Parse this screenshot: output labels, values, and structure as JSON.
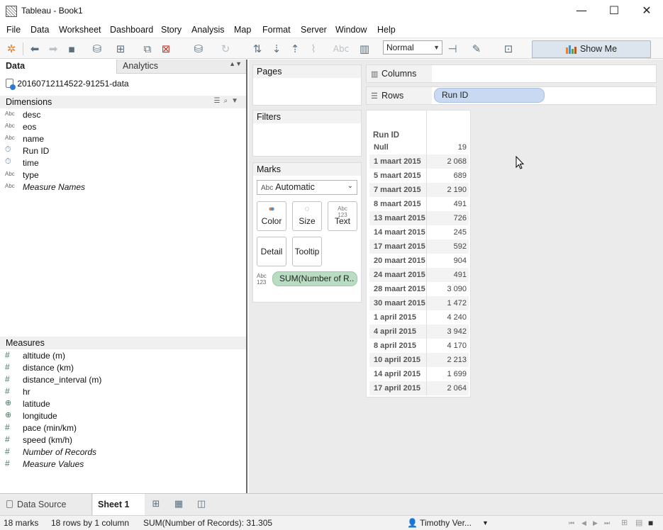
{
  "window": {
    "title": "Tableau - Book1",
    "min": "—",
    "max": "☐",
    "close": "✕"
  },
  "menu": [
    "File",
    "Data",
    "Worksheet",
    "Dashboard",
    "Story",
    "Analysis",
    "Map",
    "Format",
    "Server",
    "Window",
    "Help"
  ],
  "toolbar": {
    "fit_mode": "Normal",
    "show_me": "Show Me",
    "abc_label": "Abc"
  },
  "leftpane": {
    "tab_data": "Data",
    "tab_analytics": "Analytics",
    "datasource": "20160712114522-91251-data",
    "dimensions_title": "Dimensions",
    "dimensions": [
      {
        "icon": "Abc",
        "label": "desc"
      },
      {
        "icon": "Abc",
        "label": "eos"
      },
      {
        "icon": "Abc",
        "label": "name"
      },
      {
        "icon": "calendar",
        "label": "Run ID"
      },
      {
        "icon": "calendar",
        "label": "time"
      },
      {
        "icon": "Abc",
        "label": "type"
      },
      {
        "icon": "Abc",
        "label": "Measure Names"
      }
    ],
    "measures_title": "Measures",
    "measures": [
      {
        "icon": "#",
        "label": "altitude (m)"
      },
      {
        "icon": "#",
        "label": "distance (km)"
      },
      {
        "icon": "#",
        "label": "distance_interval (m)"
      },
      {
        "icon": "#",
        "label": "hr"
      },
      {
        "icon": "globe",
        "label": "latitude"
      },
      {
        "icon": "globe",
        "label": "longitude"
      },
      {
        "icon": "#",
        "label": "pace (min/km)"
      },
      {
        "icon": "#",
        "label": "speed (km/h)"
      },
      {
        "icon": "#",
        "label": "Number of Records"
      },
      {
        "icon": "#",
        "label": "Measure Values"
      }
    ]
  },
  "cards": {
    "pages": "Pages",
    "filters": "Filters",
    "marks": "Marks",
    "mark_type": "Automatic",
    "mark_type_icon": "Abc",
    "color": "Color",
    "size": "Size",
    "text": "Text",
    "detail": "Detail",
    "tooltip": "Tooltip",
    "sum_pill": "SUM(Number of R..",
    "columns": "Columns",
    "rows": "Rows",
    "rows_pill": "Run ID"
  },
  "viz": {
    "header": "Run ID",
    "rows": [
      {
        "date": "Null",
        "value": "19"
      },
      {
        "date": "1 maart 2015",
        "value": "2 068"
      },
      {
        "date": "5 maart 2015",
        "value": "689"
      },
      {
        "date": "7 maart 2015",
        "value": "2 190"
      },
      {
        "date": "8 maart 2015",
        "value": "491"
      },
      {
        "date": "13 maart 2015",
        "value": "726"
      },
      {
        "date": "14 maart 2015",
        "value": "245"
      },
      {
        "date": "17 maart 2015",
        "value": "592"
      },
      {
        "date": "20 maart 2015",
        "value": "904"
      },
      {
        "date": "24 maart 2015",
        "value": "491"
      },
      {
        "date": "28 maart 2015",
        "value": "3 090"
      },
      {
        "date": "30 maart 2015",
        "value": "1 472"
      },
      {
        "date": "1 april 2015",
        "value": "4 240"
      },
      {
        "date": "4 april 2015",
        "value": "3 942"
      },
      {
        "date": "8 april 2015",
        "value": "4 170"
      },
      {
        "date": "10 april 2015",
        "value": "2 213"
      },
      {
        "date": "14 april 2015",
        "value": "1 699"
      },
      {
        "date": "17 april 2015",
        "value": "2 064"
      }
    ]
  },
  "sheets": {
    "data_source": "Data Source",
    "sheet1": "Sheet 1"
  },
  "status": {
    "marks": "18 marks",
    "rows_cols": "18 rows by 1 column",
    "sum": "SUM(Number of Records): 31.305",
    "user": "Timothy Ver..."
  }
}
